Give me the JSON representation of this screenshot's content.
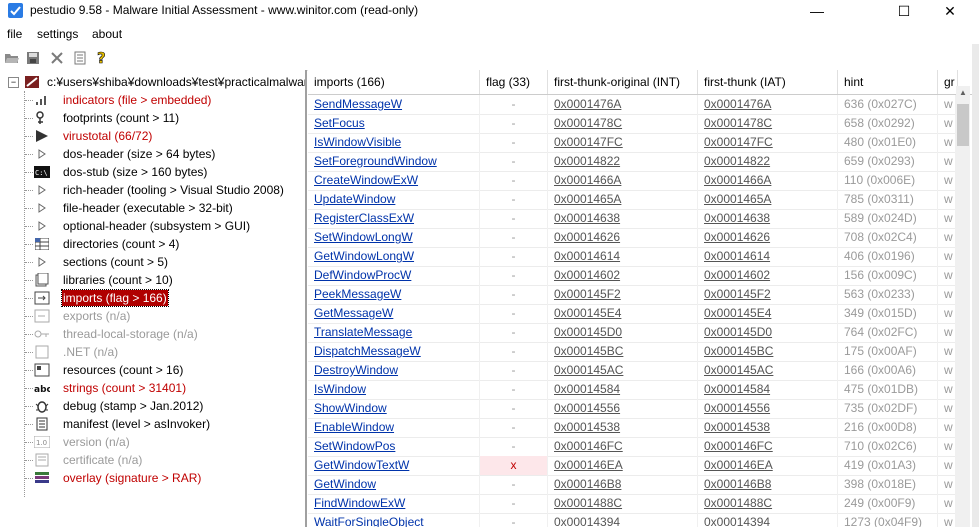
{
  "window": {
    "title": "pestudio 9.58 - Malware Initial Assessment - www.winitor.com (read-only)",
    "minimize_glyph": "—",
    "maximize_glyph": "☐",
    "close_glyph": "✕"
  },
  "menu": {
    "file": "file",
    "settings": "settings",
    "about": "about"
  },
  "tree": {
    "root_label": "c:¥users¥shiba¥downloads¥test¥practicalmalware",
    "items": [
      {
        "label": "indicators (file > embedded)",
        "style": "red",
        "icon": "bars-icon"
      },
      {
        "label": "footprints (count > 11)",
        "style": "",
        "icon": "footprints-icon"
      },
      {
        "label": "virustotal (66/72)",
        "style": "red",
        "icon": "virustotal-icon"
      },
      {
        "label": "dos-header (size > 64 bytes)",
        "style": "",
        "icon": "triangle-icon"
      },
      {
        "label": "dos-stub (size > 160 bytes)",
        "style": "",
        "icon": "console-icon"
      },
      {
        "label": "rich-header (tooling > Visual Studio 2008)",
        "style": "",
        "icon": "triangle-icon"
      },
      {
        "label": "file-header (executable > 32-bit)",
        "style": "",
        "icon": "triangle-icon"
      },
      {
        "label": "optional-header (subsystem > GUI)",
        "style": "",
        "icon": "triangle-icon"
      },
      {
        "label": "directories (count > 4)",
        "style": "",
        "icon": "grid-icon"
      },
      {
        "label": "sections (count > 5)",
        "style": "",
        "icon": "triangle-icon"
      },
      {
        "label": "libraries (count > 10)",
        "style": "",
        "icon": "library-icon"
      },
      {
        "label": "imports (flag > 166)",
        "style": "selected",
        "icon": "imports-icon"
      },
      {
        "label": "exports (n/a)",
        "style": "gray",
        "icon": "exports-icon"
      },
      {
        "label": "thread-local-storage (n/a)",
        "style": "gray",
        "icon": "key-icon"
      },
      {
        "label": ".NET (n/a)",
        "style": "gray",
        "icon": "dotnet-icon"
      },
      {
        "label": "resources (count > 16)",
        "style": "",
        "icon": "resources-icon"
      },
      {
        "label": "strings (count > 31401)",
        "style": "red",
        "icon": "abc-icon"
      },
      {
        "label": "debug (stamp > Jan.2012)",
        "style": "",
        "icon": "bug-icon"
      },
      {
        "label": "manifest (level > asInvoker)",
        "style": "",
        "icon": "manifest-icon"
      },
      {
        "label": "version (n/a)",
        "style": "gray",
        "icon": "version-icon"
      },
      {
        "label": "certificate (n/a)",
        "style": "gray",
        "icon": "certificate-icon"
      },
      {
        "label": "overlay (signature > RAR)",
        "style": "red",
        "icon": "overlay-icon"
      }
    ]
  },
  "table": {
    "headers": [
      "imports (166)",
      "flag (33)",
      "first-thunk-original (INT)",
      "first-thunk (IAT)",
      "hint",
      "gr"
    ],
    "rows": [
      [
        "SendMessageW",
        "-",
        "0x0001476A",
        "0x0001476A",
        "636 (0x027C)",
        "w"
      ],
      [
        "SetFocus",
        "-",
        "0x0001478C",
        "0x0001478C",
        "658 (0x0292)",
        "w"
      ],
      [
        "IsWindowVisible",
        "-",
        "0x000147FC",
        "0x000147FC",
        "480 (0x01E0)",
        "w"
      ],
      [
        "SetForegroundWindow",
        "-",
        "0x00014822",
        "0x00014822",
        "659 (0x0293)",
        "w"
      ],
      [
        "CreateWindowExW",
        "-",
        "0x0001466A",
        "0x0001466A",
        "110 (0x006E)",
        "w"
      ],
      [
        "UpdateWindow",
        "-",
        "0x0001465A",
        "0x0001465A",
        "785 (0x0311)",
        "w"
      ],
      [
        "RegisterClassExW",
        "-",
        "0x00014638",
        "0x00014638",
        "589 (0x024D)",
        "w"
      ],
      [
        "SetWindowLongW",
        "-",
        "0x00014626",
        "0x00014626",
        "708 (0x02C4)",
        "w"
      ],
      [
        "GetWindowLongW",
        "-",
        "0x00014614",
        "0x00014614",
        "406 (0x0196)",
        "w"
      ],
      [
        "DefWindowProcW",
        "-",
        "0x00014602",
        "0x00014602",
        "156 (0x009C)",
        "w"
      ],
      [
        "PeekMessageW",
        "-",
        "0x000145F2",
        "0x000145F2",
        "563 (0x0233)",
        "w"
      ],
      [
        "GetMessageW",
        "-",
        "0x000145E4",
        "0x000145E4",
        "349 (0x015D)",
        "w"
      ],
      [
        "TranslateMessage",
        "-",
        "0x000145D0",
        "0x000145D0",
        "764 (0x02FC)",
        "w"
      ],
      [
        "DispatchMessageW",
        "-",
        "0x000145BC",
        "0x000145BC",
        "175 (0x00AF)",
        "w"
      ],
      [
        "DestroyWindow",
        "-",
        "0x000145AC",
        "0x000145AC",
        "166 (0x00A6)",
        "w"
      ],
      [
        "IsWindow",
        "-",
        "0x00014584",
        "0x00014584",
        "475 (0x01DB)",
        "w"
      ],
      [
        "ShowWindow",
        "-",
        "0x00014556",
        "0x00014556",
        "735 (0x02DF)",
        "w"
      ],
      [
        "EnableWindow",
        "-",
        "0x00014538",
        "0x00014538",
        "216 (0x00D8)",
        "w"
      ],
      [
        "SetWindowPos",
        "-",
        "0x000146FC",
        "0x000146FC",
        "710 (0x02C6)",
        "w"
      ],
      [
        "GetWindowTextW",
        "x",
        "0x000146EA",
        "0x000146EA",
        "419 (0x01A3)",
        "w"
      ],
      [
        "GetWindow",
        "-",
        "0x000146B8",
        "0x000146B8",
        "398 (0x018E)",
        "w"
      ],
      [
        "FindWindowExW",
        "-",
        "0x0001488C",
        "0x0001488C",
        "249 (0x00F9)",
        "w"
      ],
      [
        "WaitForSingleObject",
        "-",
        "0x00014394",
        "0x00014394",
        "1273 (0x04F9)",
        "w"
      ]
    ]
  }
}
